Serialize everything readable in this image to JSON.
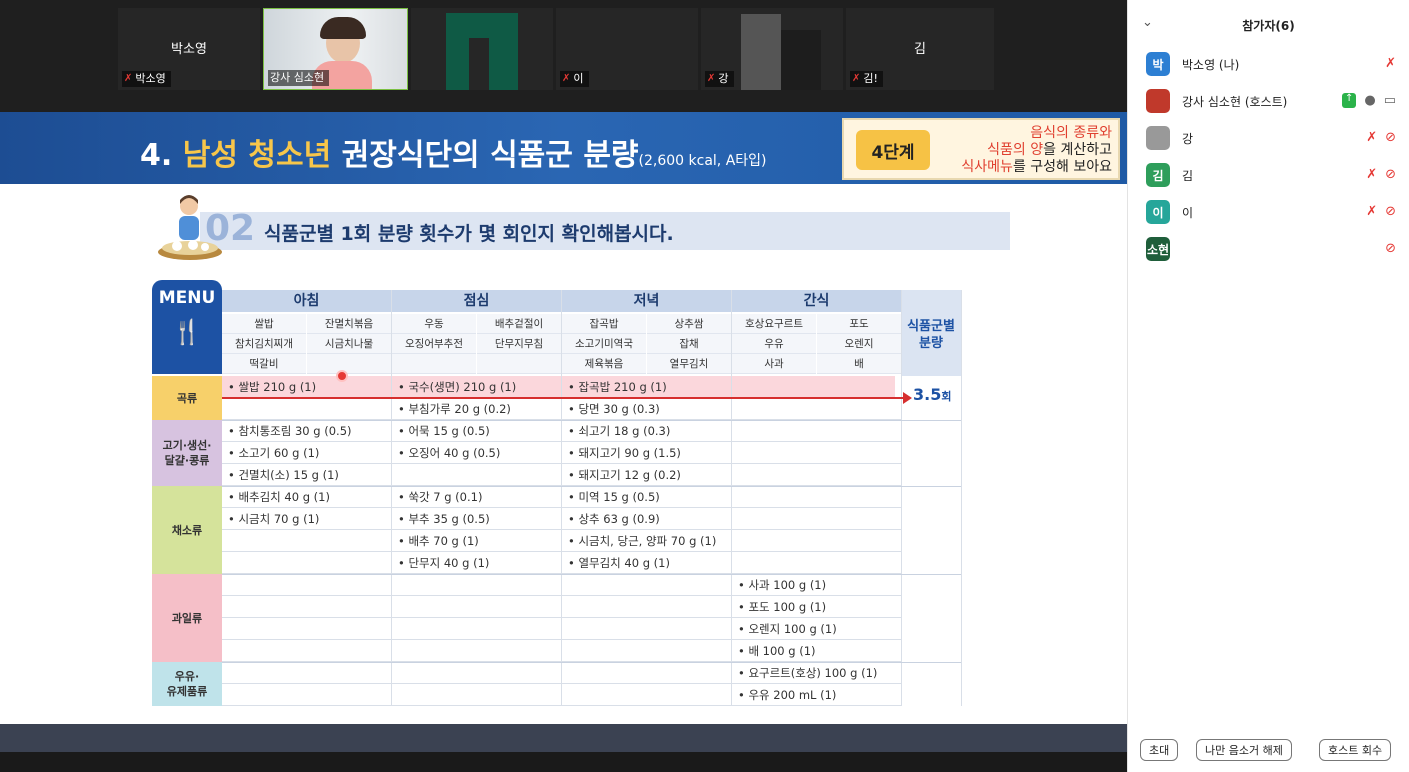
{
  "videos": [
    {
      "center_name": "박소영",
      "caption": "박소영",
      "muted": true
    },
    {
      "center_name": "",
      "caption": "강사 심소현",
      "muted": false,
      "active": true
    },
    {
      "center_name": "",
      "caption": "",
      "muted": false
    },
    {
      "center_name": "",
      "caption": "이",
      "muted": true
    },
    {
      "center_name": "",
      "caption": "강",
      "muted": true
    },
    {
      "center_name": "김",
      "caption": "김!",
      "muted": true
    }
  ],
  "slide": {
    "title_num": "4.",
    "title_highlight": "남성 청소년",
    "title_rest": "권장식단의 식품군 분량",
    "title_sub": "(2,600 kcal, A타입)",
    "step_badge": "4단계",
    "step_line1": "음식의 종류와",
    "step_line2_red": "식품의 양",
    "step_line2_rest": "을 계산하고",
    "step_line3_red": "식사메뉴",
    "step_line3_rest": "를 구성해 보아요",
    "section_num": "02",
    "section_text": "식품군별 1회 분량 횟수가 몇 회인지 확인해봅시다.",
    "menu_label": "MENU",
    "meals": [
      {
        "name": "아침",
        "items": [
          "쌀밥",
          "잔멸치볶음",
          "참치김치찌개",
          "시금치나물",
          "떡갈비",
          ""
        ]
      },
      {
        "name": "점심",
        "items": [
          "우동",
          "배추겉절이",
          "오징어부추전",
          "단무지무침",
          "",
          ""
        ]
      },
      {
        "name": "저녁",
        "items": [
          "잡곡밥",
          "상추쌈",
          "소고기미역국",
          "잡채",
          "제육볶음",
          "열무김치"
        ]
      },
      {
        "name": "간식",
        "items": [
          "호상요구르트",
          "포도",
          "우유",
          "오렌지",
          "사과",
          "배"
        ]
      }
    ],
    "serving_head": "식품군별\n분량",
    "serving_value": "3.5",
    "serving_unit": "회",
    "groups": [
      {
        "label": "곡류"
      },
      {
        "label": "고기·생선·\n달걀·콩류"
      },
      {
        "label": "채소류"
      },
      {
        "label": "과일류"
      },
      {
        "label": "우유·\n유제품류"
      }
    ],
    "foods": {
      "grain": [
        [
          "• 쌀밥 210 g (1)",
          "• 국수(생면) 210 g (1)",
          "• 잡곡밥 210 g (1)",
          ""
        ],
        [
          "",
          "• 부침가루 20 g (0.2)",
          "• 당면 30 g (0.3)",
          ""
        ]
      ],
      "meat": [
        [
          "• 참치통조림 30 g (0.5)",
          "• 어묵 15 g (0.5)",
          "• 쇠고기 18 g (0.3)",
          ""
        ],
        [
          "• 소고기 60 g (1)",
          "• 오징어 40 g (0.5)",
          "• 돼지고기 90 g (1.5)",
          ""
        ],
        [
          "• 건멸치(소) 15 g (1)",
          "",
          "• 돼지고기 12 g (0.2)",
          ""
        ]
      ],
      "veg": [
        [
          "• 배추김치 40 g (1)",
          "• 쑥갓 7 g (0.1)",
          "• 미역 15 g (0.5)",
          ""
        ],
        [
          "• 시금치 70 g (1)",
          "• 부추 35 g (0.5)",
          "• 상추 63 g (0.9)",
          ""
        ],
        [
          "",
          "• 배추 70 g (1)",
          "• 시금치, 당근, 양파 70 g (1)",
          ""
        ],
        [
          "",
          "• 단무지 40 g (1)",
          "• 열무김치 40 g (1)",
          ""
        ]
      ],
      "fruit": [
        [
          "",
          "",
          "",
          "• 사과 100 g (1)"
        ],
        [
          "",
          "",
          "",
          "• 포도 100 g (1)"
        ],
        [
          "",
          "",
          "",
          "• 오렌지 100 g (1)"
        ],
        [
          "",
          "",
          "",
          "• 배 100 g (1)"
        ]
      ],
      "milk": [
        [
          "",
          "",
          "",
          "• 요구르트(호상) 100 g (1)"
        ],
        [
          "",
          "",
          "",
          "• 우유 200 mL (1)"
        ]
      ]
    }
  },
  "panel": {
    "title": "참가자(6)",
    "participants": [
      {
        "avatar": "박",
        "color": "#2d7fd3",
        "name": "박소영 (나)",
        "icons": [
          "mute"
        ]
      },
      {
        "avatar": "",
        "color": "#c0392b",
        "name": "강사 심소현 (호스트)",
        "icons": [
          "share",
          "mic",
          "video"
        ]
      },
      {
        "avatar": "",
        "color": "#999999",
        "name": "강",
        "icons": [
          "mute",
          "video-off"
        ]
      },
      {
        "avatar": "김",
        "color": "#2e9e5b",
        "name": "김",
        "icons": [
          "mute",
          "video-off"
        ]
      },
      {
        "avatar": "이",
        "color": "#26a69a",
        "name": "이",
        "icons": [
          "mute",
          "video-off"
        ]
      },
      {
        "avatar": "소현",
        "color": "#1f5e3b",
        "name": "",
        "icons": [
          "video-off"
        ]
      }
    ],
    "buttons": {
      "invite": "초대",
      "unmute_me": "나만 음소거 해제",
      "reclaim_host": "호스트 회수"
    }
  }
}
